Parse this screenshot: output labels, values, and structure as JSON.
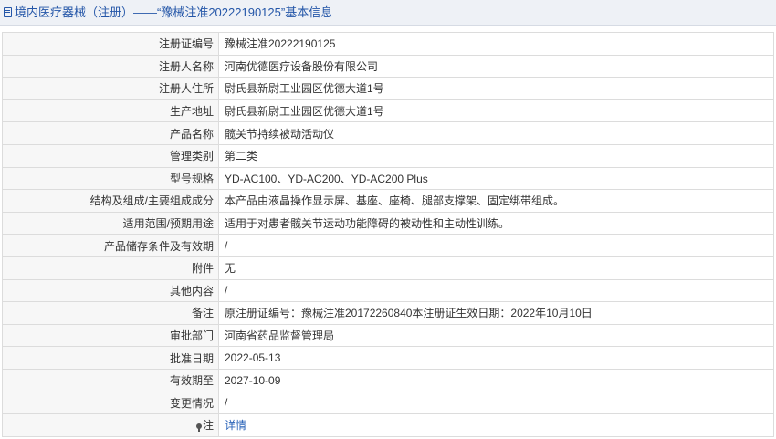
{
  "header": {
    "title": "境内医疗器械（注册）——“豫械注准20222190125”基本信息",
    "icon": "document-icon",
    "color": "#2456a8"
  },
  "rows": [
    {
      "label": "注册证编号",
      "value": "豫械注准20222190125"
    },
    {
      "label": "注册人名称",
      "value": "河南优德医疗设备股份有限公司"
    },
    {
      "label": "注册人住所",
      "value": "尉氏县新尉工业园区优德大道1号"
    },
    {
      "label": "生产地址",
      "value": "尉氏县新尉工业园区优德大道1号"
    },
    {
      "label": "产品名称",
      "value": "髋关节持续被动活动仪"
    },
    {
      "label": "管理类别",
      "value": "第二类"
    },
    {
      "label": "型号规格",
      "value": "YD-AC100、YD-AC200、YD-AC200 Plus"
    },
    {
      "label": "结构及组成/主要组成成分",
      "value": "本产品由液晶操作显示屏、基座、座椅、腿部支撑架、固定绑带组成。"
    },
    {
      "label": "适用范围/预期用途",
      "value": "适用于对患者髋关节运动功能障碍的被动性和主动性训练。"
    },
    {
      "label": "产品储存条件及有效期",
      "value": "/"
    },
    {
      "label": "附件",
      "value": "无"
    },
    {
      "label": "其他内容",
      "value": "/"
    },
    {
      "label": "备注",
      "value": "原注册证编号：豫械注准20172260840本注册证生效日期：2022年10月10日"
    },
    {
      "label": "审批部门",
      "value": "河南省药品监督管理局"
    },
    {
      "label": "批准日期",
      "value": "2022-05-13"
    },
    {
      "label": "有效期至",
      "value": "2027-10-09"
    },
    {
      "label": "变更情况",
      "value": "/"
    },
    {
      "label": "注",
      "value": "详情",
      "icon": "pin-icon"
    }
  ]
}
